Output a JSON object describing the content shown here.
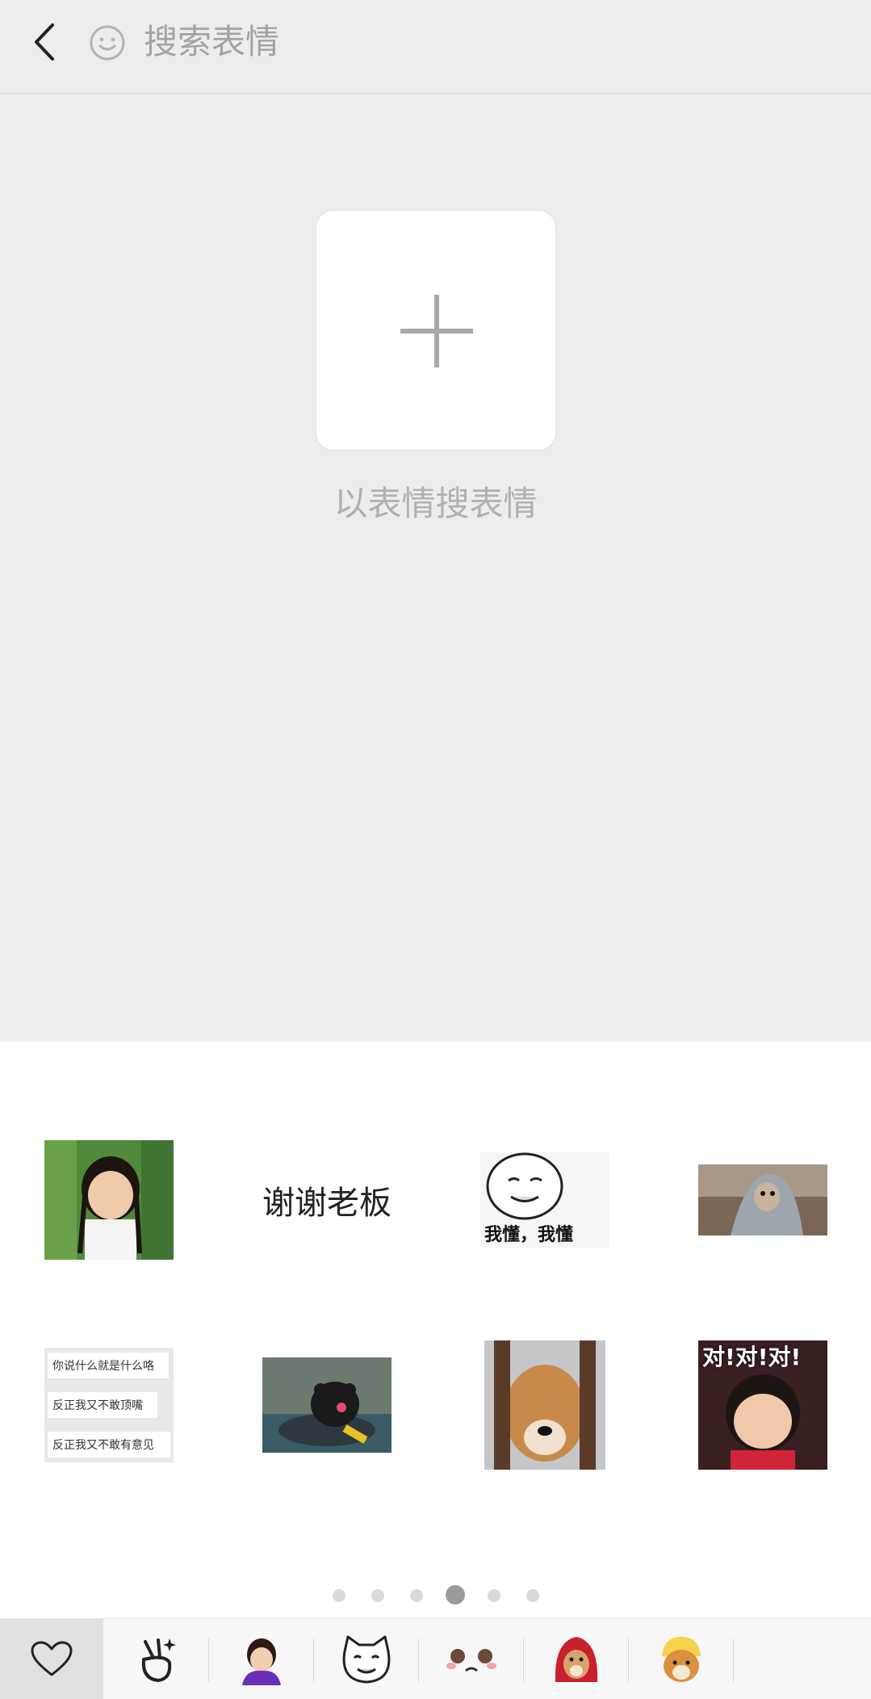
{
  "header": {
    "back_icon": "chevron-left-icon",
    "emoji_icon": "smiley-face-icon",
    "search_placeholder": "搜索表情"
  },
  "add_area": {
    "icon": "plus-icon",
    "caption": "以表情搜表情"
  },
  "stickers": {
    "row1": [
      {
        "type": "image",
        "description": "girl-with-pigtails"
      },
      {
        "type": "text",
        "text": "谢谢老板"
      },
      {
        "type": "image",
        "description": "meme-face",
        "caption": "我懂，我懂"
      },
      {
        "type": "image",
        "description": "dog-with-blanket"
      }
    ],
    "row2": [
      {
        "type": "image",
        "lines": [
          "你说什么就是什么咯",
          "反正我又不敢顶嘴",
          "反正我又不敢有意见"
        ]
      },
      {
        "type": "image",
        "description": "kumamon-boat"
      },
      {
        "type": "image",
        "description": "shiba-behind-bars"
      },
      {
        "type": "image",
        "description": "boy-meme",
        "caption": "对!对!对!"
      }
    ]
  },
  "pager": {
    "count": 6,
    "active": 3
  },
  "tabbar": {
    "items": [
      {
        "icon": "heart-icon",
        "selected": true
      },
      {
        "icon": "peace-hand-icon"
      },
      {
        "icon": "baby-sticker-icon"
      },
      {
        "icon": "cat-face-sticker-icon"
      },
      {
        "icon": "blush-face-sticker-icon"
      },
      {
        "icon": "dog-red-hood-sticker-icon"
      },
      {
        "icon": "shiba-yellow-hat-sticker-icon"
      }
    ]
  },
  "colors": {
    "background": "#ededed",
    "panel": "#ffffff",
    "placeholder": "#a3a3a3",
    "dot_active": "#9b9b9b",
    "dot": "#dadada"
  }
}
